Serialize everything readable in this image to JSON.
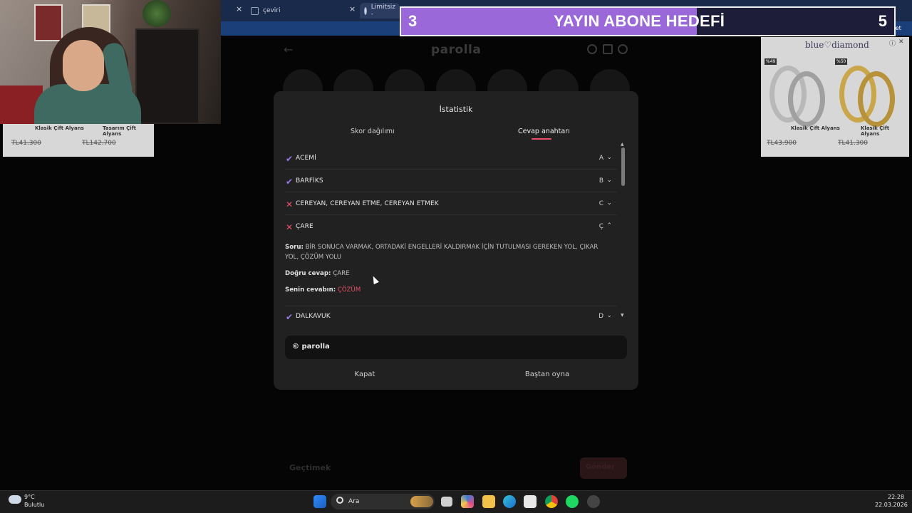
{
  "browser": {
    "tabs": [
      {
        "label": "çeviri"
      },
      {
        "label": "Limitsiz -"
      }
    ],
    "tab_close": "×"
  },
  "overlay": {
    "goal_current": "3",
    "goal_title": "YAYIN ABONE HEDEFİ",
    "goal_target": "5",
    "goal_progress": 0.6,
    "chat_label": "Sohbet et"
  },
  "ads": {
    "left_items": [
      {
        "name": "Klasik Çift Alyans",
        "price": "TL41.300"
      },
      {
        "name": "Tasarım Çift Alyans",
        "price": "TL142.700"
      }
    ],
    "right_brand": "blue♡diamond",
    "right_items": [
      {
        "badge": "%49",
        "name": "Klasik Çift Alyans",
        "price": "TL43.900"
      },
      {
        "badge": "%50",
        "name": "Klasik Çift Alyans",
        "price": "TL41.300"
      }
    ]
  },
  "game": {
    "title": "parolla",
    "input_placeholder": "Geçtimek",
    "button_label": "Gönder"
  },
  "modal": {
    "title": "İstatistik",
    "tabs": [
      "Skor dağılımı",
      "Cevap anahtarı"
    ],
    "active_tab": "Cevap anahtarı",
    "answers": [
      {
        "status": "correct",
        "word": "ACEMİ",
        "letter": "A"
      },
      {
        "status": "correct",
        "word": "BARFİKS",
        "letter": "B"
      },
      {
        "status": "wrong",
        "word": "CEREYAN, CEREYAN ETME, CEREYAN ETMEK",
        "letter": "C"
      },
      {
        "status": "wrong",
        "word": "ÇARE",
        "letter": "Ç",
        "expanded": true
      },
      {
        "status": "correct",
        "word": "DALKAVUK",
        "letter": "D"
      }
    ],
    "detail": {
      "question_label": "Soru:",
      "question_text": "BİR SONUCA VARMAK, ORTADAKİ ENGELLERİ KALDIRMAK İÇİN TUTULMASI GEREKEN YOL, ÇIKAR YOL, ÇÖZÜM YOLU",
      "correct_label": "Doğru cevap:",
      "correct_text": "ÇARE",
      "user_label": "Senin cevabın:",
      "user_text": "ÇÖZÜM"
    },
    "footer": "© parolla",
    "close_label": "Kapat",
    "restart_label": "Baştan oyna"
  },
  "taskbar": {
    "weather_temp": "9°C",
    "weather_desc": "Bulutlu",
    "search_label": "Ara",
    "time": "22:28",
    "date": "22.03.2026"
  },
  "colors": {
    "accent_purple": "#9b7be8",
    "accent_red": "#e8506a",
    "modal_bg": "#212121"
  }
}
